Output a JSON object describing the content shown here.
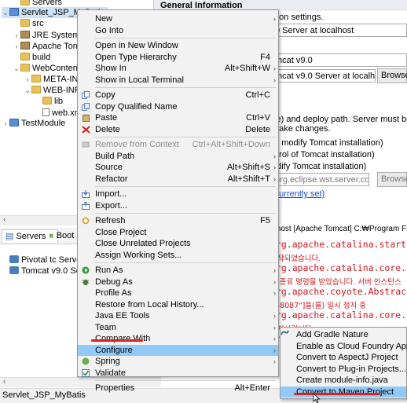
{
  "explorer": {
    "items": [
      {
        "label": "Servers",
        "level": 1,
        "arrow": "",
        "icon": "folder-icon"
      },
      {
        "label": "Servlet_JSP_MyBatis",
        "level": 0,
        "arrow": "v",
        "icon": "project-icon"
      },
      {
        "label": "src",
        "level": 1,
        "arrow": "",
        "icon": "folder-icon"
      },
      {
        "label": "JRE System Lib",
        "level": 1,
        "arrow": ">",
        "icon": "library-icon"
      },
      {
        "label": "Apache Tomca",
        "level": 1,
        "arrow": ">",
        "icon": "library-icon"
      },
      {
        "label": "build",
        "level": 1,
        "arrow": "",
        "icon": "folder-icon"
      },
      {
        "label": "WebContent",
        "level": 1,
        "arrow": "v",
        "icon": "folder-icon"
      },
      {
        "label": "META-INF",
        "level": 2,
        "arrow": ">",
        "icon": "folder-icon"
      },
      {
        "label": "WEB-INF",
        "level": 2,
        "arrow": "v",
        "icon": "folder-icon"
      },
      {
        "label": "lib",
        "level": 3,
        "arrow": "",
        "icon": "folder-icon"
      },
      {
        "label": "web.xml",
        "level": 3,
        "arrow": "",
        "icon": "file-icon"
      },
      {
        "label": "TestModule",
        "level": 0,
        "arrow": ">",
        "icon": "project-icon"
      }
    ]
  },
  "editor": {
    "section_title": "General Information",
    "desc": "mon settings.",
    "server_name_value": "0 Server at localhost",
    "runtime_value": "mcat v9.0",
    "config_value": "mcat v9.0 Server at localhost-",
    "browse_label": "Browse...",
    "deploy_text_1": "se) and deploy path. Server must be",
    "deploy_text_2": "make changes.",
    "opt1": "ot modify Tomcat installation)",
    "opt2": "ntrol of Tomcat installation)",
    "opt3": "odify Tomcat installation)",
    "deploy_path_value": "org.eclipse.wst.server.core\\",
    "browse2_label": "Browse...",
    "link_text": "(currently set)"
  },
  "servers_view": {
    "tab_servers": "Servers",
    "tab_boot": "Boot D",
    "items": [
      "Pivotal tc Server D",
      "Tomcat v9.0 Serve"
    ]
  },
  "console": {
    "header": "alhost [Apache Tomcat] C:₩Program Fil",
    "lines": [
      {
        "text": "org.apache.catalina.start",
        "small": false
      },
      {
        "text": "시작되었습니다.",
        "small": true
      },
      {
        "text": "org.apache.catalina.core.",
        "small": false
      },
      {
        "text": "인 종료 명령을 받았습니다. 서버 인스턴스",
        "small": true
      },
      {
        "text": "org.apache.coyote.Abstrac",
        "small": false
      },
      {
        "text": "io-8087\"]을(를) 일시 정지 중",
        "small": true
      },
      {
        "text": "org.apache.catalina.core.",
        "small": false
      },
      {
        "text": "중지시킵니다.",
        "small": true
      },
      {
        "text": "org.apache.catalina.core.",
        "small": false
      }
    ]
  },
  "status": {
    "text": "Servlet_JSP_MyBatis"
  },
  "menu": {
    "items": [
      {
        "type": "item",
        "label": "New",
        "shortcut": "",
        "sub": true,
        "icon": ""
      },
      {
        "type": "item",
        "label": "Go Into",
        "shortcut": "",
        "sub": false,
        "icon": ""
      },
      {
        "type": "sep"
      },
      {
        "type": "item",
        "label": "Open in New Window",
        "shortcut": "",
        "sub": false,
        "icon": ""
      },
      {
        "type": "item",
        "label": "Open Type Hierarchy",
        "shortcut": "F4",
        "sub": false,
        "icon": ""
      },
      {
        "type": "item",
        "label": "Show In",
        "shortcut": "Alt+Shift+W",
        "sub": true,
        "icon": ""
      },
      {
        "type": "item",
        "label": "Show in Local Terminal",
        "shortcut": "",
        "sub": true,
        "icon": ""
      },
      {
        "type": "sep"
      },
      {
        "type": "item",
        "label": "Copy",
        "shortcut": "Ctrl+C",
        "sub": false,
        "icon": "copy-icon"
      },
      {
        "type": "item",
        "label": "Copy Qualified Name",
        "shortcut": "",
        "sub": false,
        "icon": "copy-qualified-icon"
      },
      {
        "type": "item",
        "label": "Paste",
        "shortcut": "Ctrl+V",
        "sub": false,
        "icon": "paste-icon"
      },
      {
        "type": "item",
        "label": "Delete",
        "shortcut": "Delete",
        "sub": false,
        "icon": "delete-icon"
      },
      {
        "type": "sep"
      },
      {
        "type": "item",
        "label": "Remove from Context",
        "shortcut": "Ctrl+Alt+Shift+Down",
        "sub": false,
        "icon": "remove-context-icon",
        "disabled": true
      },
      {
        "type": "item",
        "label": "Build Path",
        "shortcut": "",
        "sub": true,
        "icon": ""
      },
      {
        "type": "item",
        "label": "Source",
        "shortcut": "Alt+Shift+S",
        "sub": true,
        "icon": ""
      },
      {
        "type": "item",
        "label": "Refactor",
        "shortcut": "Alt+Shift+T",
        "sub": true,
        "icon": ""
      },
      {
        "type": "sep"
      },
      {
        "type": "item",
        "label": "Import...",
        "shortcut": "",
        "sub": false,
        "icon": "import-icon"
      },
      {
        "type": "item",
        "label": "Export...",
        "shortcut": "",
        "sub": false,
        "icon": "export-icon"
      },
      {
        "type": "sep"
      },
      {
        "type": "item",
        "label": "Refresh",
        "shortcut": "F5",
        "sub": false,
        "icon": "refresh-icon"
      },
      {
        "type": "item",
        "label": "Close Project",
        "shortcut": "",
        "sub": false,
        "icon": ""
      },
      {
        "type": "item",
        "label": "Close Unrelated Projects",
        "shortcut": "",
        "sub": false,
        "icon": ""
      },
      {
        "type": "item",
        "label": "Assign Working Sets...",
        "shortcut": "",
        "sub": false,
        "icon": ""
      },
      {
        "type": "sep"
      },
      {
        "type": "item",
        "label": "Run As",
        "shortcut": "",
        "sub": true,
        "icon": "run-icon"
      },
      {
        "type": "item",
        "label": "Debug As",
        "shortcut": "",
        "sub": true,
        "icon": "debug-icon"
      },
      {
        "type": "item",
        "label": "Profile As",
        "shortcut": "",
        "sub": true,
        "icon": ""
      },
      {
        "type": "item",
        "label": "Restore from Local History...",
        "shortcut": "",
        "sub": false,
        "icon": ""
      },
      {
        "type": "item",
        "label": "Java EE Tools",
        "shortcut": "",
        "sub": true,
        "icon": ""
      },
      {
        "type": "item",
        "label": "Team",
        "shortcut": "",
        "sub": true,
        "icon": ""
      },
      {
        "type": "item",
        "label": "Compare With",
        "shortcut": "",
        "sub": true,
        "icon": ""
      },
      {
        "type": "item",
        "label": "Configure",
        "shortcut": "",
        "sub": true,
        "icon": "",
        "highlighted": true
      },
      {
        "type": "item",
        "label": "Spring",
        "shortcut": "",
        "sub": true,
        "icon": "spring-icon"
      },
      {
        "type": "item",
        "label": "Validate",
        "shortcut": "",
        "sub": false,
        "icon": "validate-icon"
      },
      {
        "type": "sep"
      },
      {
        "type": "item",
        "label": "Properties",
        "shortcut": "Alt+Enter",
        "sub": false,
        "icon": ""
      }
    ]
  },
  "submenu": {
    "items": [
      {
        "label": "Add Gradle Nature",
        "icon": "gradle-icon"
      },
      {
        "label": "Enable as Cloud Foundry App",
        "icon": ""
      },
      {
        "label": "Convert to AspectJ Project",
        "icon": ""
      },
      {
        "label": "Convert to Plug-in Projects...",
        "icon": ""
      },
      {
        "label": "Create module-info.java",
        "icon": ""
      },
      {
        "label": "Convert to Maven Project",
        "icon": "",
        "highlighted": true
      }
    ]
  },
  "colors": {
    "highlight": "#91c9f7",
    "annotation_red": "#e02020",
    "console_red": "#d1141c"
  }
}
